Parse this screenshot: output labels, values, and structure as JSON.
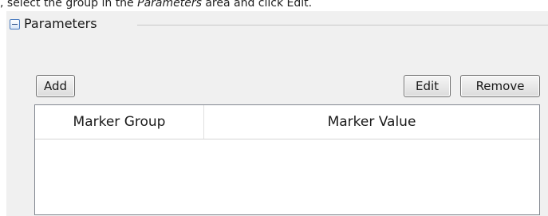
{
  "caption": {
    "prefix": ", select the group in the ",
    "emphasis": "Parameters",
    "suffix": " area and click Edit."
  },
  "group": {
    "title": "Parameters",
    "toggle_icon": "collapse-minus-icon"
  },
  "buttons": {
    "add": "Add",
    "edit": "Edit",
    "remove": "Remove"
  },
  "table": {
    "columns": [
      "Marker Group",
      "Marker Value"
    ],
    "rows": []
  }
}
